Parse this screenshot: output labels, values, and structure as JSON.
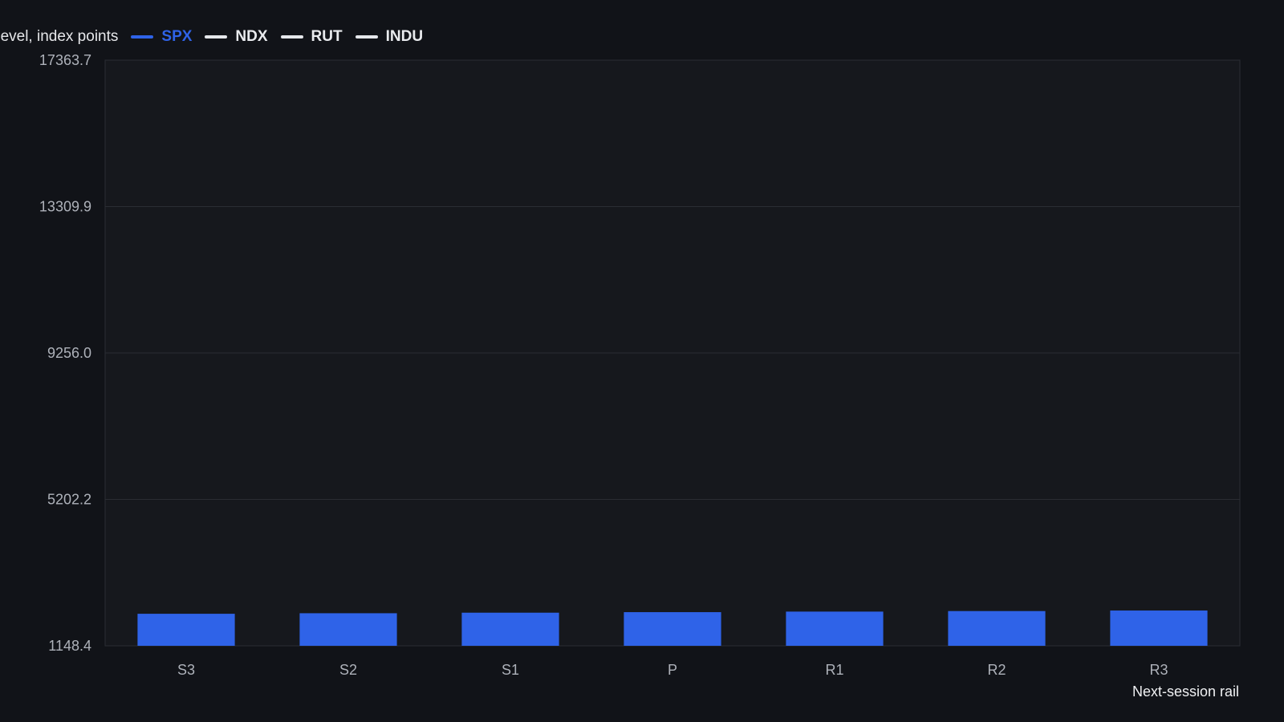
{
  "chart_data": {
    "type": "bar",
    "ylabel": "Level, index points",
    "xlabel": "Next-session rail",
    "categories": [
      "S3",
      "S2",
      "S1",
      "P",
      "R1",
      "R2",
      "R3"
    ],
    "series": [
      {
        "name": "SPX",
        "values": [
          2035,
          2050,
          2065,
          2080,
          2095,
          2110,
          2125
        ],
        "color": "#2f63e8"
      },
      {
        "name": "NDX",
        "color": "#e5e7eb"
      },
      {
        "name": "RUT",
        "color": "#e5e7eb"
      },
      {
        "name": "INDU",
        "color": "#e5e7eb"
      }
    ],
    "active_series": "SPX",
    "yticks": [
      "17363.7",
      "13309.9",
      "9256.0",
      "5202.2",
      "1148.4"
    ],
    "ylim": [
      1148.4,
      17363.7
    ],
    "grid": true,
    "legend_position": "top-left"
  },
  "colors": {
    "background": "#111318",
    "plot_background": "#16181d",
    "grid": "#2a2d33",
    "axis_text": "#aeb2ba"
  }
}
